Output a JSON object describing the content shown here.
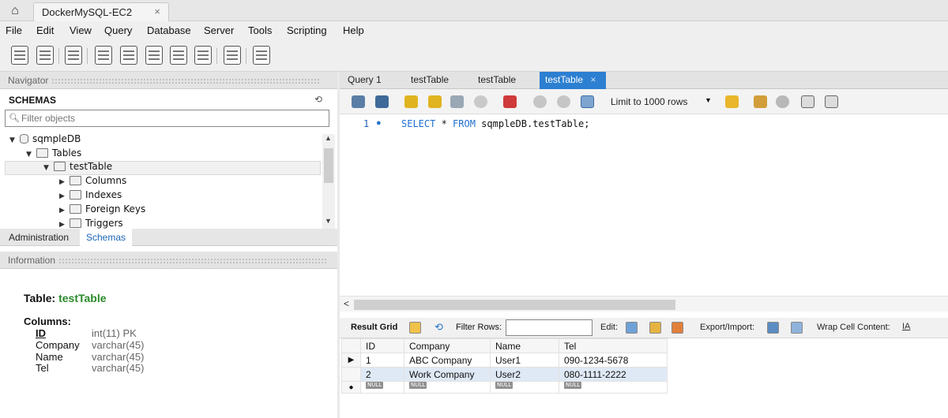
{
  "app": {
    "connection_tab": "DockerMySQL-EC2",
    "close_glyph": "×",
    "home_icon": "home-icon"
  },
  "menu": [
    "File",
    "Edit",
    "View",
    "Query",
    "Database",
    "Server",
    "Tools",
    "Scripting",
    "Help"
  ],
  "navigator": {
    "header": "Navigator",
    "schemas_label": "SCHEMAS",
    "filter_placeholder": "Filter objects",
    "tree": {
      "schema": "sqmpleDB",
      "tables_folder": "Tables",
      "table": "testTable",
      "children": [
        "Columns",
        "Indexes",
        "Foreign Keys",
        "Triggers"
      ]
    },
    "tabs": {
      "administration": "Administration",
      "schemas": "Schemas"
    }
  },
  "information": {
    "header": "Information",
    "table_prefix": "Table: ",
    "table_name": "testTable",
    "columns_label": "Columns:",
    "columns": [
      {
        "name": "ID",
        "type": "int(11) PK"
      },
      {
        "name": "Company",
        "type": "varchar(45)"
      },
      {
        "name": "Name",
        "type": "varchar(45)"
      },
      {
        "name": "Tel",
        "type": "varchar(45)"
      }
    ]
  },
  "query_tabs": [
    "Query 1",
    "testTable",
    "testTable",
    "testTable"
  ],
  "query_toolbar": {
    "limit": "Limit to 1000 rows"
  },
  "editor": {
    "line_number": "1",
    "sql_kw1": "SELECT",
    "sql_mid": " * ",
    "sql_kw2": "FROM",
    "sql_rest": " sqmpleDB.testTable;"
  },
  "result_toolbar": {
    "result_grid": "Result Grid",
    "filter_rows": "Filter Rows:",
    "edit": "Edit:",
    "export_import": "Export/Import:",
    "wrap": "Wrap Cell Content:"
  },
  "grid": {
    "headers": [
      "ID",
      "Company",
      "Name",
      "Tel"
    ],
    "rows": [
      [
        "1",
        "ABC Company",
        "User1",
        "090-1234-5678"
      ],
      [
        "2",
        "Work Company",
        "User2",
        "080-1111-2222"
      ]
    ],
    "null_label": "NULL"
  }
}
